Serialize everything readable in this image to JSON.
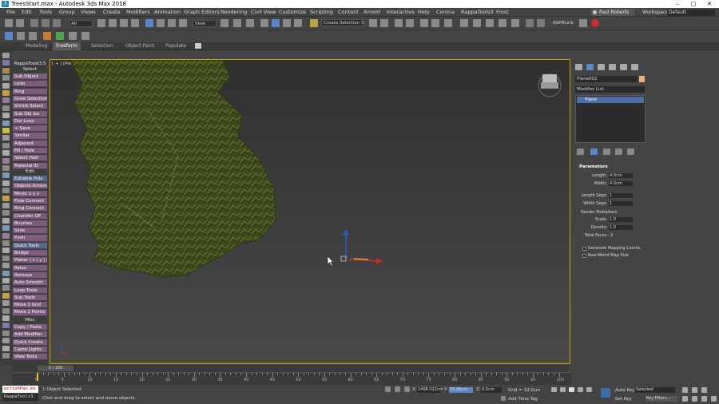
{
  "window": {
    "title": "TreesStart.max - Autodesk 3ds Max 2018",
    "logo": "3",
    "minimize": "–",
    "maximize": "□",
    "close": "✕"
  },
  "menu": [
    "File",
    "Edit",
    "Tools",
    "Group",
    "Views",
    "Create",
    "Modifiers",
    "Animation",
    "Graph Editors",
    "Rendering",
    "Civil View",
    "Customize",
    "Scripting",
    "Content",
    "Arnold",
    "Interactive",
    "Help",
    "Corona",
    "RappaTools3",
    "Frost"
  ],
  "user": {
    "name": "Paul Roberts",
    "workspaces_label": "Workspaces:",
    "workspace": "Default"
  },
  "toolbar": {
    "filter": "All",
    "view": "View",
    "selection_set": "Create Selection Se",
    "asp_link": "ASPRLink"
  },
  "ribbon": {
    "tabs": [
      "Modeling",
      "Freeform",
      "Selection",
      "Object Paint",
      "Populate"
    ],
    "active": "Freeform"
  },
  "rappatools": {
    "header": "RappaTools3.5",
    "sections": {
      "select": "Select",
      "edit": "Edit",
      "misc": "Misc"
    },
    "select_buttons": [
      "Sub Object",
      "Loop",
      "Ring",
      "Grow Selection",
      "Shrink Select",
      "Sub Obj Iso",
      "Dot Loop",
      "+ Save",
      "Similar",
      "Adjacent",
      "Fill / Hole",
      "Select Half",
      "Material ID"
    ],
    "edit_buttons": [
      "Editable Poly",
      "Objects Actions",
      "Mirror  x  y  z",
      "Flow Connect",
      "Ring Connect",
      "Chamfer OP",
      "Brushes",
      "Slide",
      "Push",
      "Quick Tools",
      "Bridge",
      "Planar | x | y | z",
      "Relax",
      "Remove",
      "Auto Smooth",
      "Loop Tools",
      "Sub Tools",
      "Move 2 Gnd",
      "Move 2 Points"
    ],
    "misc_buttons": [
      "Copy / Paste",
      "Add Modifier",
      "Quick Create",
      "Came Lights",
      "View Tools"
    ]
  },
  "viewport": {
    "label": "[ + ] [Perspective ] [User Defined ] [Default Shading ]"
  },
  "command_panel": {
    "object_name": "Plane002",
    "object_color": "#f0b07a",
    "modifier_list": "Modifier List",
    "stack": [
      "Plane"
    ],
    "parameters": {
      "title": "Parameters",
      "length_label": "Length:",
      "length": "4.0cm",
      "width_label": "Width:",
      "width": "4.0cm",
      "length_segs_label": "Length Segs:",
      "length_segs": "1",
      "width_segs_label": "Width Segs:",
      "width_segs": "1",
      "render_mult_label": "Render Multipliers",
      "scale_label": "Scale:",
      "scale": "1.0",
      "density_label": "Density:",
      "density": "1.0",
      "total_faces": "Total Faces : 2",
      "gen_mapping": "Generate Mapping Coords.",
      "real_world": "Real-World Map Size"
    }
  },
  "timeline": {
    "slider": "0 / 100",
    "ticks": [
      "0",
      "5",
      "10",
      "15",
      "20",
      "25",
      "30",
      "35",
      "40",
      "45",
      "50",
      "55",
      "60",
      "65",
      "70",
      "75",
      "80",
      "85",
      "90",
      "95",
      "100"
    ]
  },
  "status": {
    "maxscript_1": "ectionPan.ms",
    "maxscript_2": "RappaTools3.",
    "selected": "1 Object Selected",
    "prompt": "Click and drag to select and move objects",
    "x_value": "1408.022cm",
    "y_value": "55.86cm",
    "z_value": "0.0cm",
    "grid": "Grid = 10.0cm",
    "add_time_tag": "Add Time Tag",
    "auto_key": "Auto Key",
    "selected_dd": "Selected",
    "set_key": "Set Key",
    "key_filters": "Key Filters..."
  },
  "colors": {
    "accent_blue": "#4d6fa8",
    "rappa_purple": "#7d5b7d",
    "viewport_border": "#c8a000"
  }
}
